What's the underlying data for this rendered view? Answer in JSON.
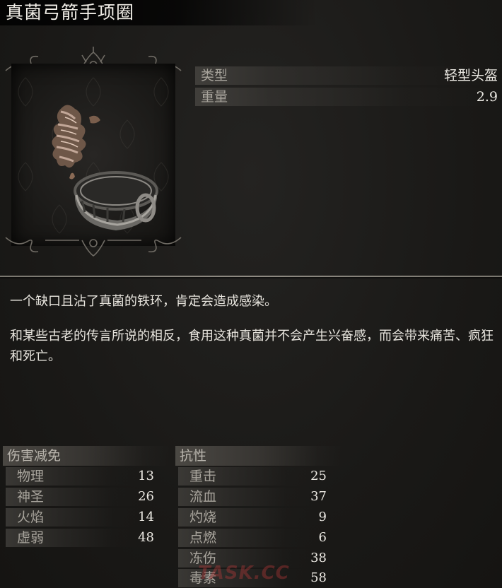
{
  "item": {
    "name": "真菌弓箭手项圈",
    "description": [
      "一个缺口且沾了真菌的铁环，肯定会造成感染。",
      "和某些古老的传言所说的相反，食用这种真菌并不会产生兴奋感，而会带来痛苦、疯狂和死亡。"
    ]
  },
  "stats": [
    {
      "label": "类型",
      "value": "轻型头盔"
    },
    {
      "label": "重量",
      "value": "2.9"
    }
  ],
  "damage_reduction": {
    "title": "伤害减免",
    "rows": [
      {
        "label": "物理",
        "value": "13"
      },
      {
        "label": "神圣",
        "value": "26"
      },
      {
        "label": "火焰",
        "value": "14"
      },
      {
        "label": "虚弱",
        "value": "48"
      }
    ]
  },
  "resistance": {
    "title": "抗性",
    "rows": [
      {
        "label": "重击",
        "value": "25"
      },
      {
        "label": "流血",
        "value": "37"
      },
      {
        "label": "灼烧",
        "value": "9"
      },
      {
        "label": "点燃",
        "value": "6"
      },
      {
        "label": "冻伤",
        "value": "38"
      },
      {
        "label": "毒素",
        "value": "58"
      }
    ]
  },
  "watermark": "TASK.CC",
  "icons": {
    "item_art": "fungal-collar-item-icon",
    "ornament": "gothic-ornament-icon"
  }
}
